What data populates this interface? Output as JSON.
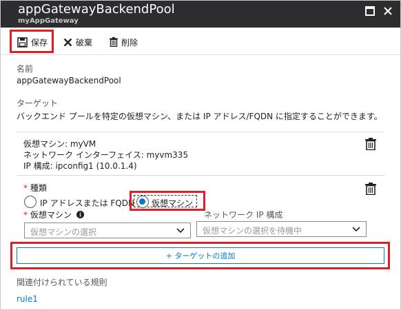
{
  "header": {
    "title": "appGatewayBackendPool",
    "subtitle": "myAppGateway",
    "maximize_icon": "maximize-icon",
    "close_icon": "close-icon"
  },
  "toolbar": {
    "save_label": "保存",
    "discard_label": "破棄",
    "delete_label": "削除",
    "save_icon": "save-icon",
    "discard_icon": "x-icon",
    "delete_icon": "trash-icon"
  },
  "form": {
    "name_label": "名前",
    "name_value": "appGatewayBackendPool",
    "target_label": "ターゲット",
    "target_description": "バックエンド プールを特定の仮想マシン、または IP アドレス/FQDN に指定することができます。",
    "existing_target": {
      "vm_line": "仮想マシン: myVM",
      "nic_line": "ネットワーク インターフェイス: myvm335",
      "ip_line": "IP 構成: ipconfig1 (10.0.1.4)"
    },
    "type_label": "種類",
    "required_mark": "*",
    "radio_ip_label": "IP アドレスまたは FQDN",
    "radio_vm_label": "仮想マシン",
    "selected_type": "仮想マシン",
    "vm_field_label": "仮想マシン",
    "vm_placeholder": "仮想マシンの選択",
    "nic_ip_label": "ネットワーク IP 構成",
    "nic_ip_placeholder": "仮想マシンの選択を待機中",
    "add_target_label": "+ ターゲットの追加",
    "rules_label": "関連付けられている規則",
    "rule_link": "rule1"
  },
  "colors": {
    "titlebar": "#2d2d30",
    "accent": "#0078d4",
    "highlight": "#e01e27"
  }
}
